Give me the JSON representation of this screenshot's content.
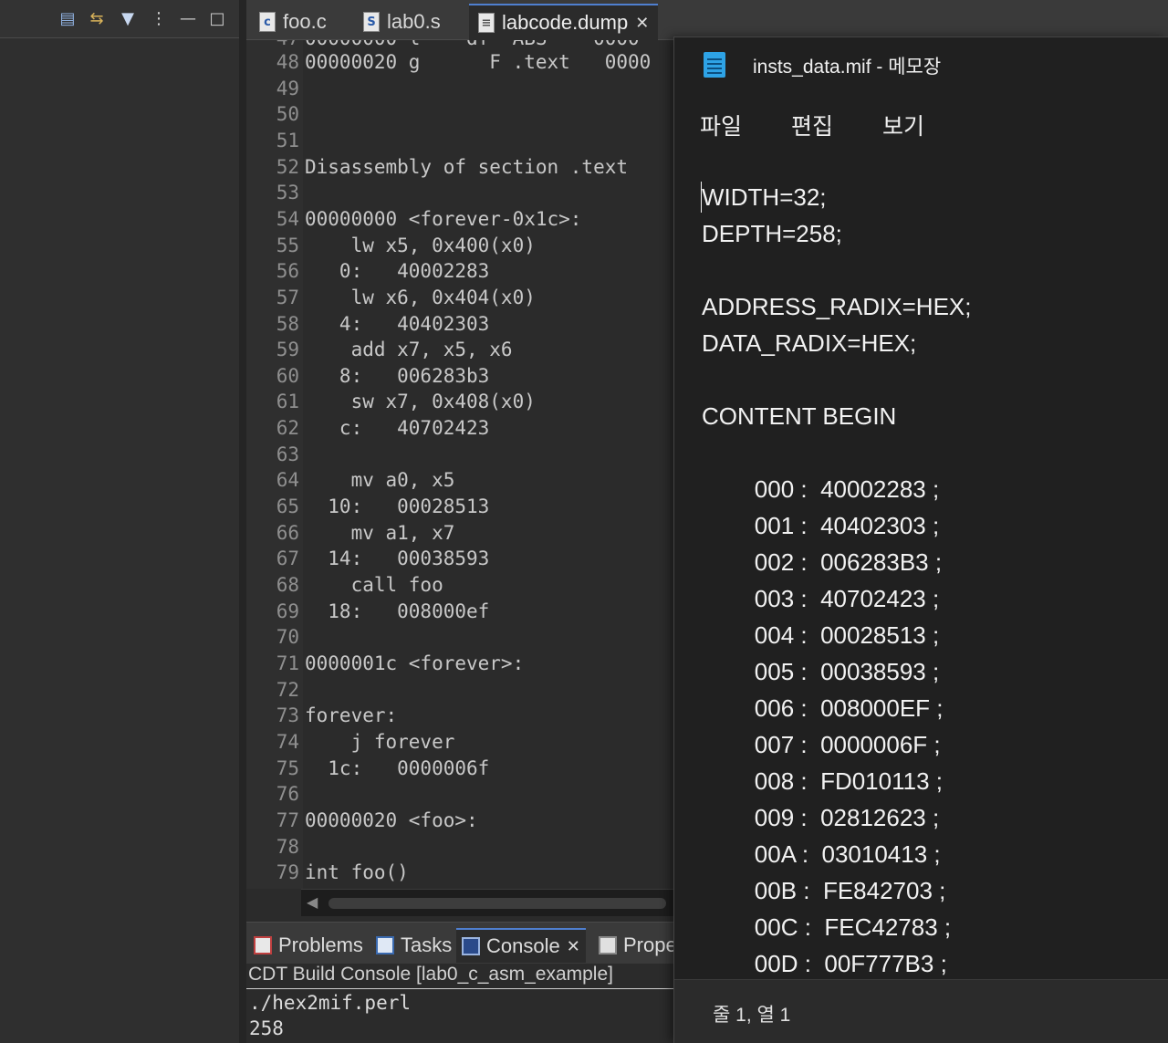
{
  "left_toolbar": {
    "icons": [
      "collapse-all-icon",
      "link-with-editor-icon",
      "filter-icon",
      "view-menu-icon",
      "minimize-icon",
      "maximize-icon"
    ]
  },
  "editor_tabs": [
    {
      "label": "foo.c",
      "icon": "c-file-icon",
      "active": false
    },
    {
      "label": "lab0.s",
      "icon": "asm-file-icon",
      "active": false
    },
    {
      "label": "labcode.dump",
      "icon": "text-file-icon",
      "active": true
    }
  ],
  "editor": {
    "lines": [
      {
        "n": "48",
        "text": "00000020 g      F .text   0000"
      },
      {
        "n": "49",
        "text": ""
      },
      {
        "n": "50",
        "text": ""
      },
      {
        "n": "51",
        "text": ""
      },
      {
        "n": "52",
        "text": "Disassembly of section .text"
      },
      {
        "n": "53",
        "text": ""
      },
      {
        "n": "54",
        "text": "00000000 <forever-0x1c>:"
      },
      {
        "n": "55",
        "text": "    lw x5, 0x400(x0)"
      },
      {
        "n": "56",
        "text": "   0:   40002283"
      },
      {
        "n": "57",
        "text": "    lw x6, 0x404(x0)"
      },
      {
        "n": "58",
        "text": "   4:   40402303"
      },
      {
        "n": "59",
        "text": "    add x7, x5, x6"
      },
      {
        "n": "60",
        "text": "   8:   006283b3"
      },
      {
        "n": "61",
        "text": "    sw x7, 0x408(x0)"
      },
      {
        "n": "62",
        "text": "   c:   40702423"
      },
      {
        "n": "63",
        "text": ""
      },
      {
        "n": "64",
        "text": "    mv a0, x5"
      },
      {
        "n": "65",
        "text": "  10:   00028513"
      },
      {
        "n": "66",
        "text": "    mv a1, x7"
      },
      {
        "n": "67",
        "text": "  14:   00038593"
      },
      {
        "n": "68",
        "text": "    call foo"
      },
      {
        "n": "69",
        "text": "  18:   008000ef"
      },
      {
        "n": "70",
        "text": ""
      },
      {
        "n": "71",
        "text": "0000001c <forever>:"
      },
      {
        "n": "72",
        "text": ""
      },
      {
        "n": "73",
        "text": "forever:"
      },
      {
        "n": "74",
        "text": "    j forever"
      },
      {
        "n": "75",
        "text": "  1c:   0000006f"
      },
      {
        "n": "76",
        "text": ""
      },
      {
        "n": "77",
        "text": "00000020 <foo>:"
      },
      {
        "n": "78",
        "text": ""
      },
      {
        "n": "79",
        "text": "int foo()"
      }
    ]
  },
  "view_tabs": [
    {
      "label": "Problems",
      "icon": "problems-icon",
      "active": false
    },
    {
      "label": "Tasks",
      "icon": "tasks-icon",
      "active": false
    },
    {
      "label": "Console",
      "icon": "console-icon",
      "active": true
    },
    {
      "label": "Prope",
      "icon": "properties-icon",
      "active": false
    }
  ],
  "console": {
    "header": "CDT Build Console [lab0_c_asm_example]",
    "lines": [
      "./hex2mif.perl",
      "258"
    ]
  },
  "notepad": {
    "title": "insts_data.mif - 메모장",
    "menu": [
      "파일",
      "편집",
      "보기"
    ],
    "lines": [
      "WIDTH=32;",
      "DEPTH=258;",
      "",
      "ADDRESS_RADIX=HEX;",
      "DATA_RADIX=HEX;",
      "",
      "CONTENT BEGIN",
      "",
      "        000 :  40002283 ;",
      "        001 :  40402303 ;",
      "        002 :  006283B3 ;",
      "        003 :  40702423 ;",
      "        004 :  00028513 ;",
      "        005 :  00038593 ;",
      "        006 :  008000EF ;",
      "        007 :  0000006F ;",
      "        008 :  FD010113 ;",
      "        009 :  02812623 ;",
      "        00A :  03010413 ;",
      "        00B :  FE842703 ;",
      "        00C :  FEC42783 ;",
      "        00D :  00F777B3 ;"
    ],
    "status": "줄 1, 열 1"
  }
}
